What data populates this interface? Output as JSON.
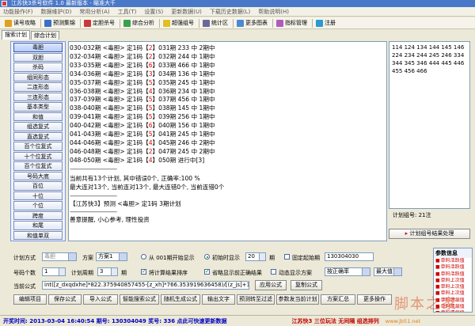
{
  "window": {
    "title": "江苏快3杀号软件 1.0 最新版本 - 瞄准大千"
  },
  "menu": [
    "功能操作(F)",
    "数据维护(D)",
    "常用分析(A)",
    "工具(T)",
    "设置(S)",
    "更新数据(U)",
    "下载历史数据(L)",
    "帮助说明(H)"
  ],
  "toolbar": [
    {
      "label": "读号攻略",
      "icon": "trophy-icon",
      "color": "#e0a020"
    },
    {
      "label": "预测集锦",
      "icon": "chart-icon",
      "color": "#3a70c8"
    },
    {
      "label": "定胆杀号",
      "icon": "target-icon",
      "color": "#c83a3a"
    },
    {
      "label": "综合分析",
      "icon": "analysis-icon",
      "color": "#3aa050"
    },
    {
      "label": "超强组号",
      "icon": "lightning-icon",
      "color": "#e0c020"
    },
    {
      "label": "统计区",
      "icon": "stats-icon",
      "color": "#6a6a9a"
    },
    {
      "label": "更多图表",
      "icon": "more-charts-icon",
      "color": "#4a8ad0"
    },
    {
      "label": "指标管理",
      "icon": "indicator-icon",
      "color": "#b05ac0"
    },
    {
      "label": "注册",
      "icon": "register-icon",
      "color": "#2a9ad0"
    }
  ],
  "tabs": [
    {
      "label": "搜索计划",
      "active": true
    },
    {
      "label": "综合计划",
      "active": false
    }
  ],
  "left_buttons": [
    "毒胆",
    "双胆",
    "杀码",
    "组同形态",
    "二连形态",
    "三连形态",
    "基本类型",
    "和值",
    "组选复式",
    "直选复式",
    "百个位复式",
    "十个位复式",
    "百个位复式",
    "号码大底",
    "百位",
    "十位",
    "个位",
    "跨度",
    "和尾",
    "和值单双"
  ],
  "left_selected_index": 0,
  "plan_rows": [
    {
      "text": "030-032期 <毒胆> 定1码【2】031期 233 中 2期中",
      "hit": "2"
    },
    {
      "text": "032-034期 <毒胆> 定1码【2】032期 244 中 1期中",
      "hit": "2"
    },
    {
      "text": "033-035期 <毒胆> 定1码【6】033期 466 中 1期中",
      "hit": "6"
    },
    {
      "text": "034-036期 <毒胆> 定1码【3】034期 136 中 1期中",
      "hit": "3"
    },
    {
      "text": "035-037期 <毒胆> 定1码【5】035期 245 中 1期中",
      "hit": "5"
    },
    {
      "text": "036-038期 <毒胆> 定1码【4】036期 234 中 1期中",
      "hit": "4"
    },
    {
      "text": "037-039期 <毒胆> 定1码【5】037期 456 中 1期中",
      "hit": "5"
    },
    {
      "text": "038-040期 <毒胆> 定1码【5】038期 145 中 1期中",
      "hit": "5"
    },
    {
      "text": "039-041期 <毒胆> 定1码【5】039期 256 中 1期中",
      "hit": "5"
    },
    {
      "text": "040-042期 <毒胆> 定1码【6】040期 156 中 1期中",
      "hit": "6"
    },
    {
      "text": "041-043期 <毒胆> 定1码【5】041期 245 中 1期中",
      "hit": "5"
    },
    {
      "text": "044-046期 <毒胆> 定1码【4】045期 246 中 2期中",
      "hit": "4"
    },
    {
      "text": "046-048期 <毒胆> 定1码【2】047期 245 中 2期中",
      "hit": "2"
    },
    {
      "text": "048-050期 <毒胆> 定1码【4】050期 进行中[3]",
      "hit": "4"
    }
  ],
  "summary": {
    "separator": "----------------------------------",
    "line1": "当前共有13个计划, 其中错误0个, 正确率:100 %",
    "line2": "最大连对13个, 当前连对13个, 最大连错0个, 当前连错0个",
    "forecast": "【江苏快3】预测 <毒胆> 定1码 3期计划",
    "tip": "善意提醒, 小心参考, 理性投资"
  },
  "right_box": {
    "numbers": "114 124 134 144 145 146 224 234 244 245 246 334 344 345 346 444 445 446 455 456 466",
    "count_label": "计划组号: 21注",
    "button_label": "计划组号结果处理"
  },
  "settings": {
    "plan_method_label": "计划方式",
    "plan_method_value": "毒胆",
    "scheme_label": "方案",
    "scheme_value": "方案1",
    "radio_from_001": "从 001期开始显示",
    "radio_initial": "初始时显示",
    "initial_periods": "20",
    "period_unit": "期",
    "fixed_start_label": "固定起始期",
    "fixed_start_value": "130304030",
    "code_count_label": "号码个数",
    "code_count_value": "1",
    "plan_cycle_label": "计划周期",
    "plan_cycle_value": "3",
    "unit_period": "期",
    "chk_sort": "将计算结果排序",
    "chk_hide_correct": "省略显示前正确结果",
    "chk_dynamic": "动态显示方案",
    "method_select": "按正确率",
    "max_select": "最大值",
    "formula_label": "当前公式",
    "formula_value": "int([z_dxqdxhe]*822.375940857455-[z_xh]*766.353919636458)/[(z_js]+117.14583495531...",
    "apply_formula": "应用公式",
    "copy_formula": "复制公式",
    "buttons": [
      "编辑项目",
      "保存公式",
      "导入公式",
      "智能搜索公式",
      "随机生成公式",
      "输出文字",
      "预测转至过滤",
      "参数发当前计划",
      "方案汇总",
      "更多操作"
    ]
  },
  "info_panel": {
    "title": "参数信息",
    "items": [
      "单码活跃值",
      "单码活跃值",
      "单码活跃值",
      "单码上次值",
      "单码上次值",
      "单码上次值",
      "单码遗漏值",
      "单码遗漏值",
      "单码遗漏值"
    ]
  },
  "status": {
    "left": "开奖时间: 2013-03-04 16:40:54  期号: 130304049  奖号: 336  点此可快速更新数据",
    "right": "江苏快3 三位玩法  无间隔  组选排列",
    "url": "www.jb51.net"
  },
  "watermark": "脚本之家"
}
